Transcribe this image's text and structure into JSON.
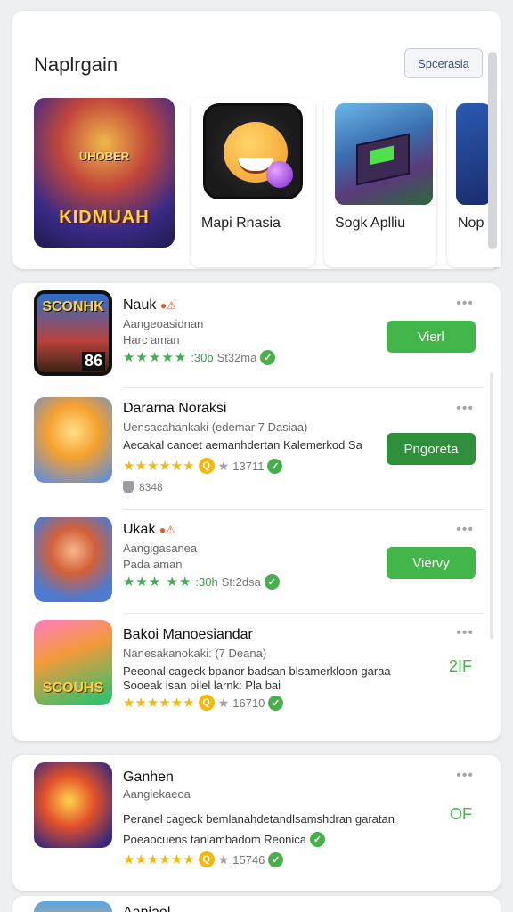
{
  "featured": {
    "title": "Naplrgain",
    "button_label": "Spcerasia",
    "big_art_top": "UHOBER",
    "big_art_text": "KIDMUAH",
    "tiles": [
      {
        "label": "Mapi Rnasia"
      },
      {
        "label": "Sogk Aplliu"
      },
      {
        "label": "Nop"
      }
    ]
  },
  "list": [
    {
      "icon_text": "SCONHK",
      "icon_num": "86",
      "title": "Nauk",
      "title_emoji": "●⚠",
      "sub1": "Aangeoasidnan",
      "sub2": "Harc aman",
      "rating_style": "green",
      "stars": "★★★★★",
      "rating_num": ":30b",
      "rating_extra": "St32ma",
      "button": "Vierl"
    },
    {
      "title": "Dararna Noraksi",
      "sub1": "Uensacahankaki (edemar 7 Dasiaa)",
      "desc1": "Aecakal canoet aemanhdertan Kalemerkod Sa",
      "rating_style": "gold",
      "stars": "★★★★★★",
      "rating_badge": "Q",
      "rating_count": "13711",
      "downloads": "8348",
      "button": "Pngoreta"
    },
    {
      "title": "Ukak",
      "title_emoji": "●⚠",
      "sub1": "Aangigasanea",
      "sub2": "Pada aman",
      "rating_style": "green",
      "stars": "★★★ ★★",
      "rating_num": ":30h",
      "rating_extra": "St:2dsa",
      "button": "Viervy"
    },
    {
      "icon_text": "SCOUHS",
      "title": "Bakoi Manoesiandar",
      "sub1": "Nanesakanokaki: (7 Deana)",
      "desc1": "Peeonal cageck bpanor badsan blsamerkloon garaa",
      "desc2": "Sooeak isan pilel larnk: Pla bai",
      "rating_style": "gold",
      "stars": "★★★★★★",
      "rating_badge": "Q",
      "rating_count": "16710",
      "price": "2IF"
    }
  ],
  "list2": [
    {
      "title": "Ganhen",
      "sub1": "Aangiekaeoa",
      "desc1": "Peranel cageck bemlanahdetandlsamshdran garatan",
      "desc2": "Poeaocuens tanlambadom Reonica",
      "rating_style": "gold",
      "stars": "★★★★★★",
      "rating_badge": "Q",
      "rating_count": "15746",
      "price": "OF"
    },
    {
      "title": "Aaniael"
    }
  ],
  "colors": {
    "accent_green": "#43b64b",
    "dark_green": "#2f8f3a",
    "star_gold": "#f3b80e"
  }
}
